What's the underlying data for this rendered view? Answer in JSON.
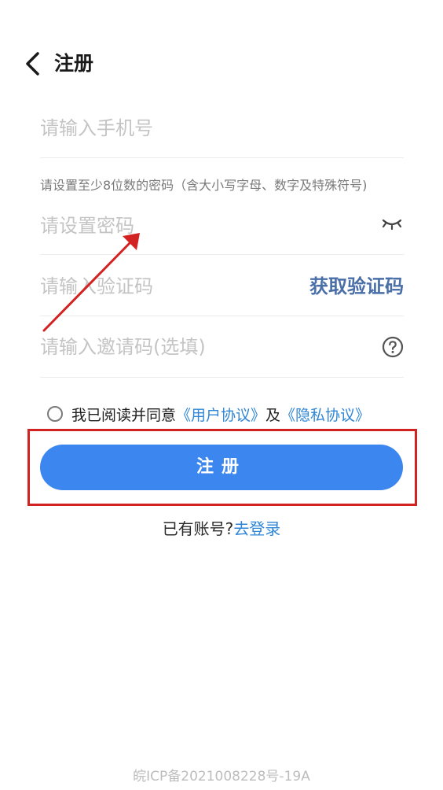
{
  "header": {
    "title": "注册",
    "back_icon": "chevron-left-icon"
  },
  "form": {
    "phone_placeholder": "请输入手机号",
    "password_hint": "请设置至少8位数的密码（含大小写字母、数字及特殊符号)",
    "password_placeholder": "请设置密码",
    "password_toggle_icon": "eye-closed-icon",
    "verify_placeholder": "请输入验证码",
    "get_code_label": "获取验证码",
    "invite_placeholder": "请输入邀请码(选填)",
    "invite_help_icon": "question-circle-icon"
  },
  "agreement": {
    "prefix": "我已阅读并同意",
    "user_agreement": "《用户协议》",
    "joiner": "及",
    "privacy_policy": "《隐私协议》"
  },
  "register_button_label": "注册",
  "login_prompt": {
    "text": "已有账号?",
    "link": "去登录"
  },
  "footer": {
    "icp": "皖ICP备2021008228号-19A"
  },
  "colors": {
    "primary": "#3c86f0",
    "link": "#2f86d6",
    "get_code": "#4a6fa8",
    "annotation": "#d32222"
  }
}
